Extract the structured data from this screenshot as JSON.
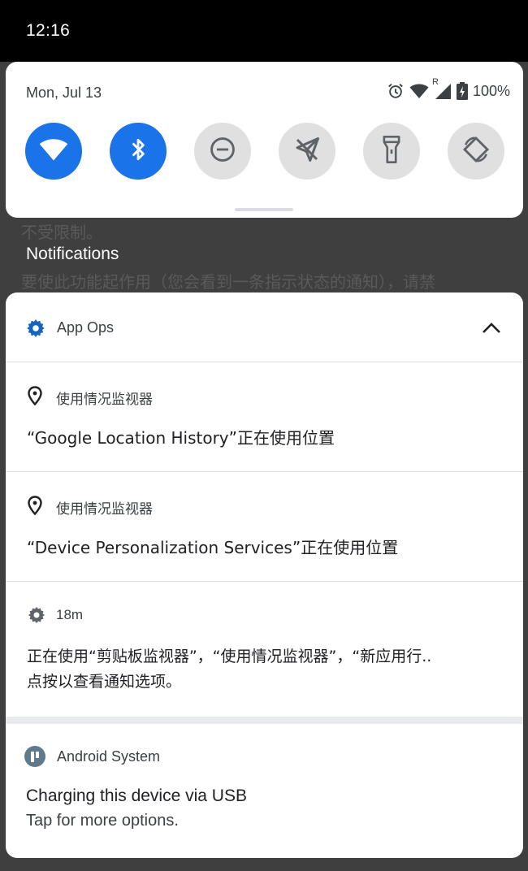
{
  "status_bar": {
    "time": "12:16"
  },
  "background": {
    "partial_text_1": "不受限制。",
    "notifications_heading": "Notifications",
    "partial_text_2": "要使此功能起作用（您会看到一条指示状态的通知），请禁"
  },
  "quick_settings": {
    "date": "Mon, Jul 13",
    "battery_percent": "100%",
    "network_tag": "R",
    "tiles": [
      {
        "name": "wifi",
        "icon": "wifi-icon",
        "active": true
      },
      {
        "name": "bluetooth",
        "icon": "bluetooth-icon",
        "active": true
      },
      {
        "name": "do-not-disturb",
        "icon": "dnd-icon",
        "active": false
      },
      {
        "name": "airplane-mode",
        "icon": "airplane-off-icon",
        "active": false
      },
      {
        "name": "flashlight",
        "icon": "flashlight-icon",
        "active": false
      },
      {
        "name": "auto-rotate",
        "icon": "rotate-icon",
        "active": false
      }
    ],
    "accent_color": "#1a73e8"
  },
  "app_ops_group": {
    "app_name": "App Ops",
    "children": [
      {
        "source": "使用情况监视器",
        "message": "“Google Location History”正在使用位置"
      },
      {
        "source": "使用情况监视器",
        "message": "“Device Personalization Services”正在使用位置"
      }
    ],
    "summary": {
      "time": "18m",
      "line1": "正在使用“剪贴板监视器”，“使用情况监视器”，“新应用行..",
      "line2": "点按以查看通知选项。"
    }
  },
  "android_system": {
    "app_name": "Android System",
    "title": "Charging this device via USB",
    "body": "Tap for more options."
  }
}
